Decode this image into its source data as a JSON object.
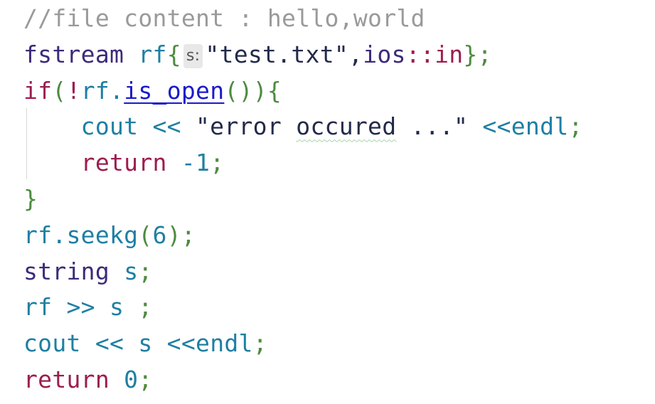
{
  "editor": {
    "lines": [
      {
        "tokens": [
          {
            "text": "//file content : hello,world",
            "kind": "comment"
          }
        ]
      },
      {
        "tokens": [
          {
            "text": "fstream",
            "kind": "type"
          },
          {
            "text": " ",
            "kind": "space"
          },
          {
            "text": "rf",
            "kind": "ident"
          },
          {
            "text": "{",
            "kind": "punct"
          },
          {
            "text": "s:",
            "kind": "hint"
          },
          {
            "text": "\"test.txt\"",
            "kind": "string"
          },
          {
            "text": ",",
            "kind": "string"
          },
          {
            "text": "ios",
            "kind": "type"
          },
          {
            "text": "::",
            "kind": "op"
          },
          {
            "text": "in",
            "kind": "keyword"
          },
          {
            "text": "}",
            "kind": "punct"
          },
          {
            "text": ";",
            "kind": "punct"
          }
        ]
      },
      {
        "tokens": [
          {
            "text": "if",
            "kind": "keyword"
          },
          {
            "text": "(",
            "kind": "punct"
          },
          {
            "text": "!",
            "kind": "op"
          },
          {
            "text": "rf",
            "kind": "ident"
          },
          {
            "text": ".",
            "kind": "ident"
          },
          {
            "text": "is_open",
            "kind": "link"
          },
          {
            "text": "()",
            "kind": "punct"
          },
          {
            "text": ")",
            "kind": "punct"
          },
          {
            "text": "{",
            "kind": "punct"
          }
        ]
      },
      {
        "tokens": [
          {
            "text": "    ",
            "kind": "space"
          },
          {
            "text": "cout",
            "kind": "ident"
          },
          {
            "text": " << ",
            "kind": "ident"
          },
          {
            "text": "\"error ",
            "kind": "string"
          },
          {
            "text": "occured",
            "kind": "string-squiggle"
          },
          {
            "text": " ...\"",
            "kind": "string"
          },
          {
            "text": " <<",
            "kind": "ident"
          },
          {
            "text": "endl",
            "kind": "ident"
          },
          {
            "text": ";",
            "kind": "punct"
          }
        ]
      },
      {
        "tokens": [
          {
            "text": "    ",
            "kind": "space"
          },
          {
            "text": "return",
            "kind": "keyword"
          },
          {
            "text": " -1",
            "kind": "number"
          },
          {
            "text": ";",
            "kind": "punct"
          }
        ]
      },
      {
        "tokens": [
          {
            "text": "}",
            "kind": "punct"
          }
        ]
      },
      {
        "tokens": [
          {
            "text": "rf",
            "kind": "ident"
          },
          {
            "text": ".",
            "kind": "ident"
          },
          {
            "text": "seekg",
            "kind": "ident"
          },
          {
            "text": "(",
            "kind": "punct"
          },
          {
            "text": "6",
            "kind": "number"
          },
          {
            "text": ")",
            "kind": "punct"
          },
          {
            "text": ";",
            "kind": "punct"
          }
        ]
      },
      {
        "tokens": [
          {
            "text": "string",
            "kind": "type"
          },
          {
            "text": " ",
            "kind": "space"
          },
          {
            "text": "s",
            "kind": "ident"
          },
          {
            "text": ";",
            "kind": "punct"
          }
        ]
      },
      {
        "tokens": [
          {
            "text": "rf",
            "kind": "ident"
          },
          {
            "text": " >> ",
            "kind": "ident"
          },
          {
            "text": "s",
            "kind": "ident"
          },
          {
            "text": " ;",
            "kind": "punct"
          }
        ]
      },
      {
        "tokens": [
          {
            "text": "cout",
            "kind": "ident"
          },
          {
            "text": " << ",
            "kind": "ident"
          },
          {
            "text": "s",
            "kind": "ident"
          },
          {
            "text": " <<",
            "kind": "ident"
          },
          {
            "text": "endl",
            "kind": "ident"
          },
          {
            "text": ";",
            "kind": "punct"
          }
        ]
      },
      {
        "tokens": [
          {
            "text": "return",
            "kind": "keyword"
          },
          {
            "text": " 0",
            "kind": "number"
          },
          {
            "text": ";",
            "kind": "punct"
          }
        ]
      }
    ]
  }
}
